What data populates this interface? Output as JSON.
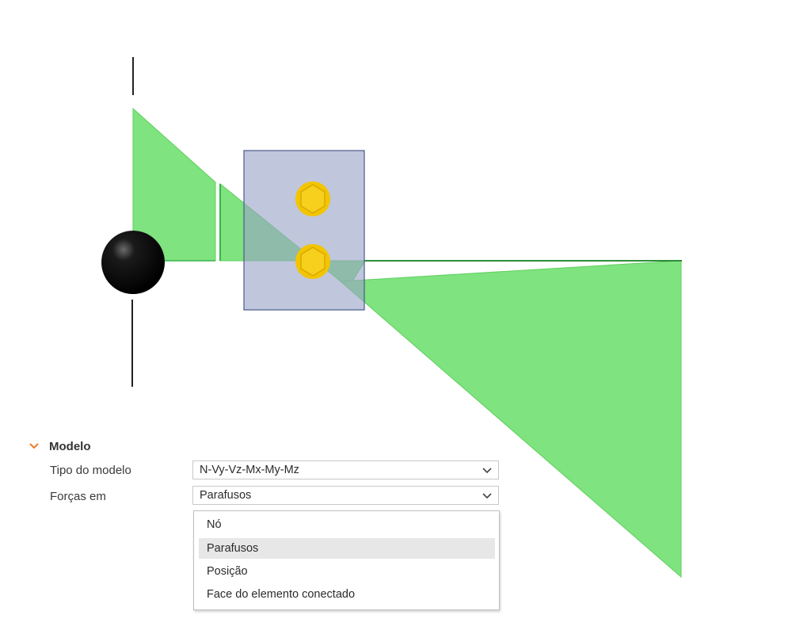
{
  "section": {
    "title": "Modelo",
    "expanded": true
  },
  "properties": [
    {
      "label": "Tipo do modelo",
      "value": "N-Vy-Vz-Mx-My-Mz"
    },
    {
      "label": "Forças em",
      "value": "Parafusos"
    }
  ],
  "dropdown": {
    "options": [
      "Nó",
      "Parafusos",
      "Posição",
      "Face do elemento conectado"
    ],
    "selected": "Parafusos"
  },
  "colors": {
    "diagram_fill": "#7fe37f",
    "diagram_line": "#39b54a",
    "plate": "#b7bdd4",
    "bolt": "#f2c500",
    "node": "#000000",
    "accent": "#f07b2b"
  },
  "icons": [
    "chevron-down-icon",
    "dropdown-caret-icon",
    "bolt-icon",
    "node-sphere-icon"
  ]
}
